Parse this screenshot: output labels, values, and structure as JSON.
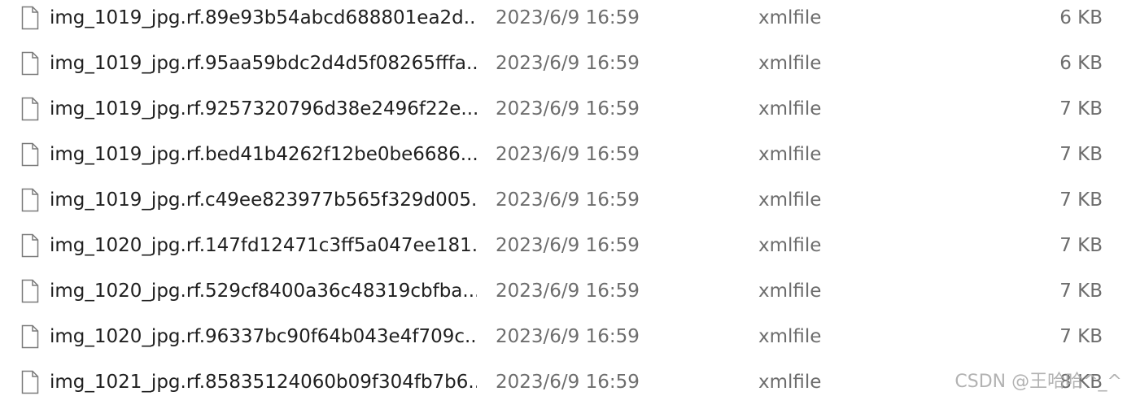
{
  "files": [
    {
      "name": "img_1019_jpg.rf.89e93b54abcd688801ea2d...",
      "modified": "2023/6/9 16:59",
      "type": "xmlfile",
      "size": "6 KB",
      "icon": "document-icon"
    },
    {
      "name": "img_1019_jpg.rf.95aa59bdc2d4d5f08265fffa...",
      "modified": "2023/6/9 16:59",
      "type": "xmlfile",
      "size": "6 KB",
      "icon": "document-icon"
    },
    {
      "name": "img_1019_jpg.rf.9257320796d38e2496f22e...",
      "modified": "2023/6/9 16:59",
      "type": "xmlfile",
      "size": "7 KB",
      "icon": "document-icon"
    },
    {
      "name": "img_1019_jpg.rf.bed41b4262f12be0be6686...",
      "modified": "2023/6/9 16:59",
      "type": "xmlfile",
      "size": "7 KB",
      "icon": "document-icon"
    },
    {
      "name": "img_1019_jpg.rf.c49ee823977b565f329d005...",
      "modified": "2023/6/9 16:59",
      "type": "xmlfile",
      "size": "7 KB",
      "icon": "document-icon"
    },
    {
      "name": "img_1020_jpg.rf.147fd12471c3ff5a047ee181...",
      "modified": "2023/6/9 16:59",
      "type": "xmlfile",
      "size": "7 KB",
      "icon": "document-icon"
    },
    {
      "name": "img_1020_jpg.rf.529cf8400a36c48319cbfba...",
      "modified": "2023/6/9 16:59",
      "type": "xmlfile",
      "size": "7 KB",
      "icon": "document-icon"
    },
    {
      "name": "img_1020_jpg.rf.96337bc90f64b043e4f709c...",
      "modified": "2023/6/9 16:59",
      "type": "xmlfile",
      "size": "7 KB",
      "icon": "document-icon"
    },
    {
      "name": "img_1021_jpg.rf.85835124060b09f304fb7b6...",
      "modified": "2023/6/9 16:59",
      "type": "xmlfile",
      "size": "8 KB",
      "icon": "document-icon"
    }
  ],
  "watermark": "CSDN @王哈哈^_^",
  "colors": {
    "name_text": "#1f1f1f",
    "meta_text": "#6d6d6d",
    "background": "#ffffff"
  }
}
